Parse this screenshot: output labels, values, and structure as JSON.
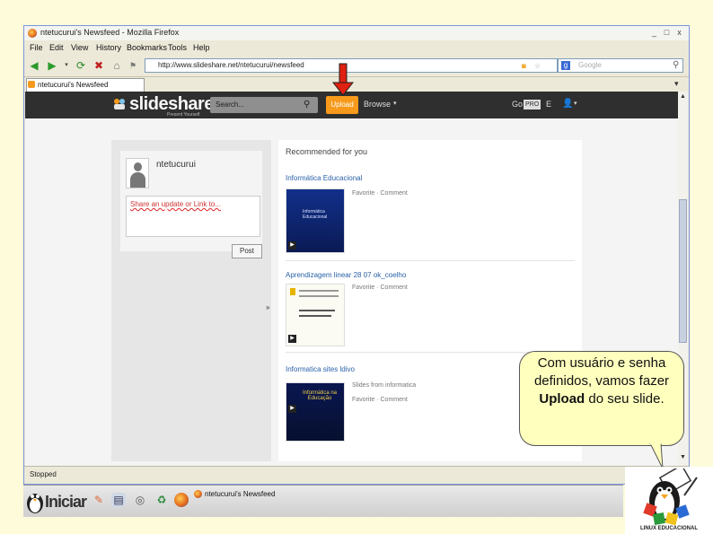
{
  "window": {
    "title": "ntetucurui's Newsfeed - Mozilla Firefox",
    "controls": [
      "_",
      "□",
      "x"
    ]
  },
  "menu": {
    "items": [
      "File",
      "Edit",
      "View",
      "History",
      "Bookmarks",
      "Tools",
      "Help"
    ]
  },
  "navbar": {
    "url": "http://www.slideshare.net/ntetucurui/newsfeed",
    "search_placeholder": "Google"
  },
  "tabs": [
    {
      "label": "ntetucurui's Newsfeed"
    }
  ],
  "slideshare": {
    "logo_main": "slideshare",
    "tagline": "Present Yourself",
    "search_placeholder": "Search...",
    "upload_label": "Upload",
    "browse_label": "Browse",
    "go_label": "Go",
    "pro_badge": "PRO",
    "lang_label": "E",
    "user_label": "▲"
  },
  "profile": {
    "username": "ntetucurui",
    "status_text": "Share an update or Link to...",
    "post_button": "Post"
  },
  "recommended": {
    "heading": "Recommended for you",
    "items": [
      {
        "title": "Informática Educacional",
        "links": "Favorite · Comment",
        "uploader": ""
      },
      {
        "title": "Aprendizagem linear 28 07 ok_coelho",
        "links": "Favorite · Comment",
        "uploader": ""
      },
      {
        "title": "Informatica sites ldivo",
        "links": "Favorite · Comment",
        "uploader": "Slides from informatica"
      }
    ],
    "thumb3_text": "Informática na Educação"
  },
  "statusbar": {
    "text": "Stopped"
  },
  "callout": {
    "line1": "Com usuário e senha definidos, vamos fazer ",
    "bold": "Upload",
    "line2": " do seu slide."
  },
  "taskbar": {
    "start_label": "Iniciar",
    "task_label": "ntetucurui's Newsfeed"
  },
  "logo": {
    "label": "LINUX EDUCACIONAL"
  },
  "colors": {
    "upload_orange": "#f79a1c",
    "header_dark": "#2f2f2f",
    "link_blue": "#2a61a8",
    "callout_bg": "#ffffbe",
    "arrow_red": "#e02010"
  }
}
